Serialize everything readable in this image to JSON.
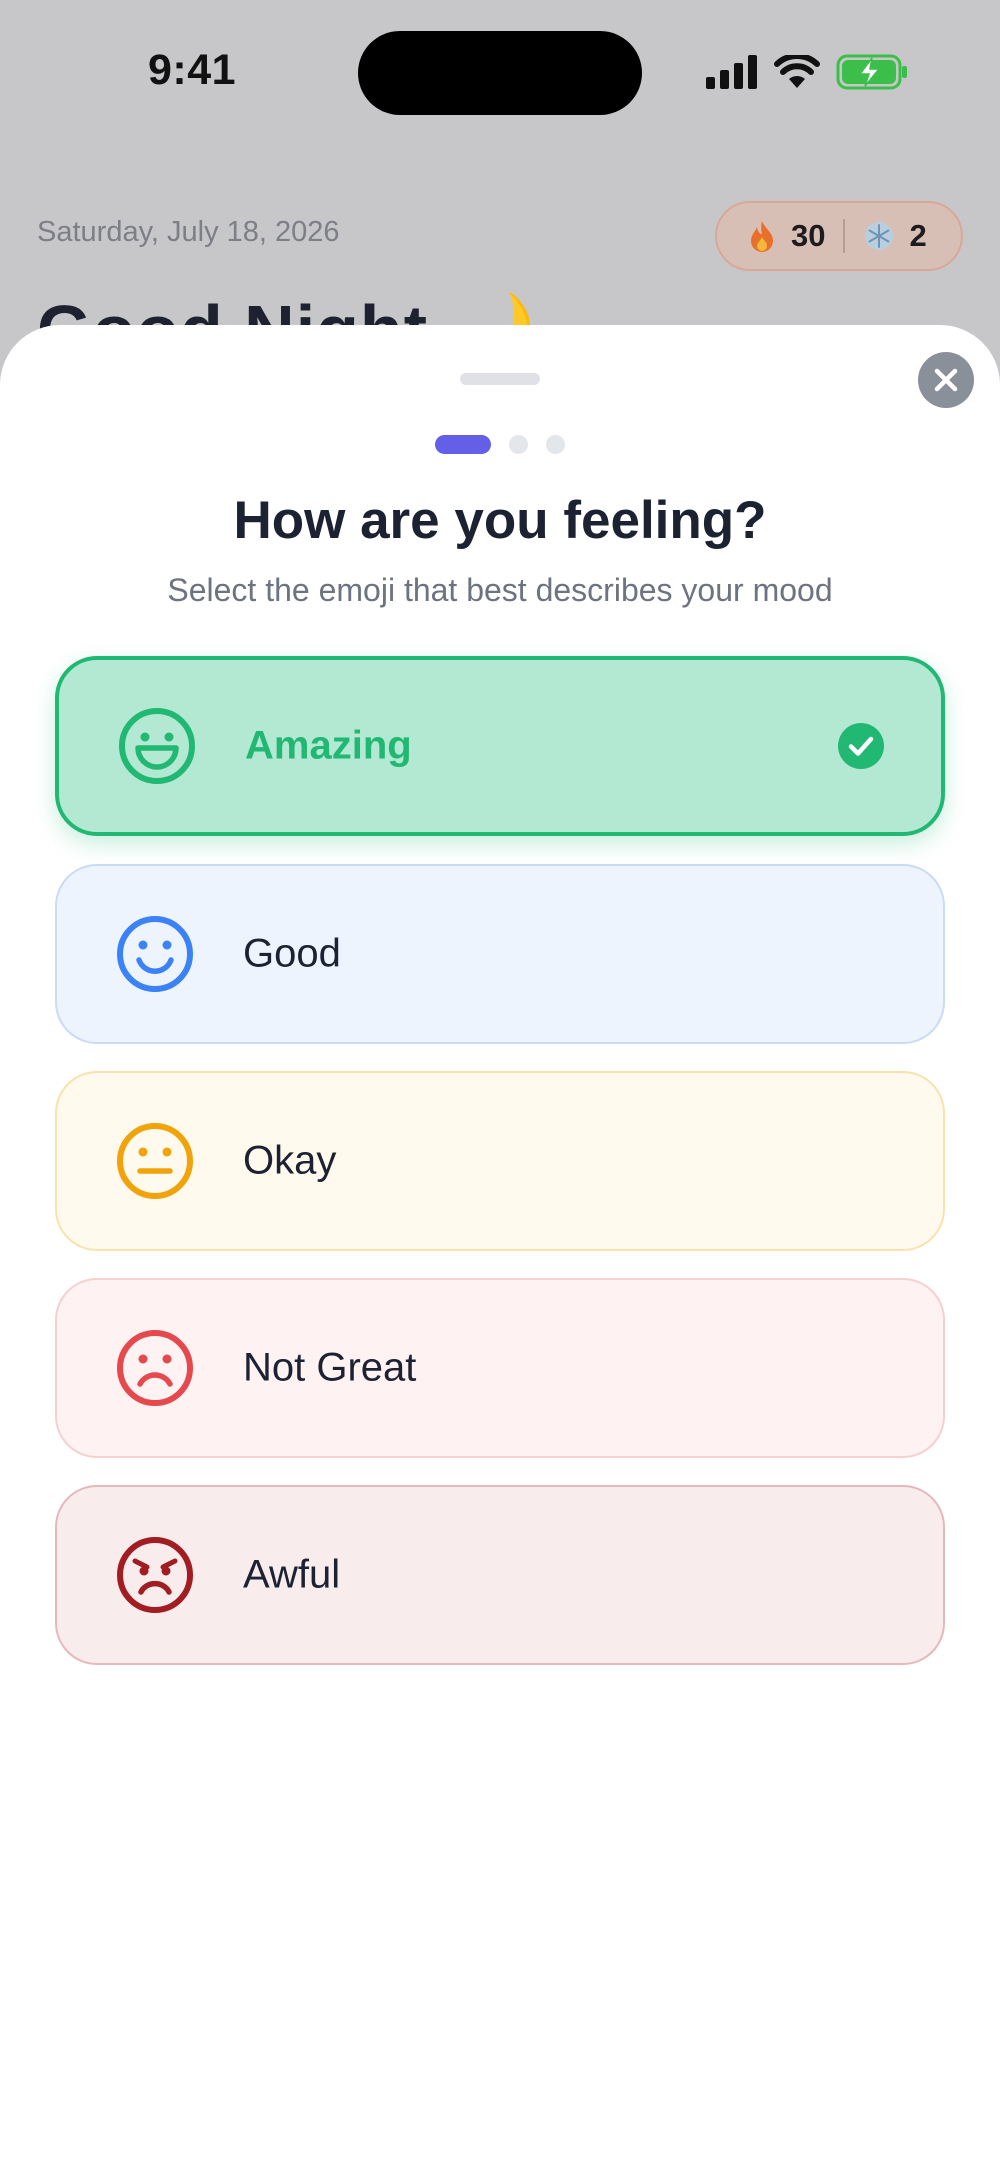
{
  "status_bar": {
    "time": "9:41"
  },
  "background": {
    "date": "Saturday, July 18, 2026",
    "greeting": "Good Night 🌙",
    "streak": {
      "fire_icon": "fire-icon",
      "fire_count": "30",
      "freeze_icon": "snowflake-icon",
      "freeze_count": "2"
    }
  },
  "sheet": {
    "step_total": 3,
    "step_current": 1,
    "title": "How are you feeling?",
    "subtitle": "Select the emoji that best describes your mood",
    "moods": [
      {
        "label": "Amazing",
        "icon": "grin-face-icon",
        "selected": true,
        "color": "#21b873",
        "bg": "#b3e8d2",
        "border": "#21b873"
      },
      {
        "label": "Good",
        "icon": "smile-face-icon",
        "selected": false,
        "color": "#3b82f6",
        "bg": "#eef4fe",
        "border": "#c9dbf5"
      },
      {
        "label": "Okay",
        "icon": "neutral-face-icon",
        "selected": false,
        "color": "#f0a30a",
        "bg": "#fff9ee",
        "border": "#f9e2ae"
      },
      {
        "label": "Not Great",
        "icon": "sad-face-icon",
        "selected": false,
        "color": "#e5484d",
        "bg": "#fff2f2",
        "border": "#f6cfd1"
      },
      {
        "label": "Awful",
        "icon": "angry-face-icon",
        "selected": false,
        "color": "#a11d22",
        "bg": "#f9eced",
        "border": "#e5b9bc"
      }
    ]
  }
}
